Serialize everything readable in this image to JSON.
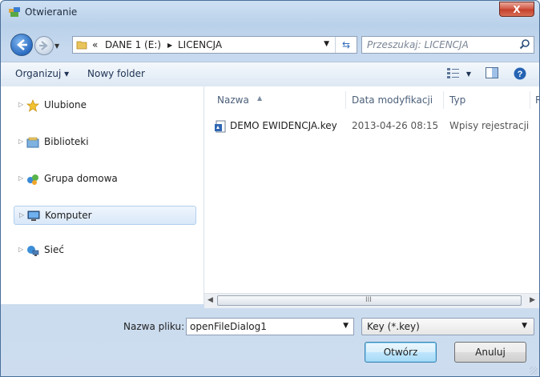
{
  "window": {
    "title": "Otwieranie",
    "close_label": "X"
  },
  "nav": {
    "address": {
      "overflow": "«",
      "segments": [
        "DANE 1 (E:)",
        "LICENCJA"
      ]
    },
    "search_placeholder": "Przeszukaj: LICENCJA"
  },
  "toolbar": {
    "organize": "Organizuj ▾",
    "new_folder": "Nowy folder"
  },
  "sidebar": {
    "items": [
      {
        "label": "Ulubione",
        "icon": "star-icon"
      },
      {
        "label": "Biblioteki",
        "icon": "libraries-icon"
      },
      {
        "label": "Grupa domowa",
        "icon": "homegroup-icon"
      },
      {
        "label": "Komputer",
        "icon": "computer-icon",
        "selected": true
      },
      {
        "label": "Sieć",
        "icon": "network-icon"
      }
    ]
  },
  "columns": [
    "Nazwa",
    "Data modyfikacji",
    "Typ",
    "R"
  ],
  "files": [
    {
      "name": "DEMO EWIDENCJA.key",
      "date": "2013-04-26 08:15",
      "type": "Wpisy rejestracji",
      "icon": "registry-file-icon"
    }
  ],
  "bottom": {
    "filename_label": "Nazwa pliku:",
    "filename_value": "openFileDialog1",
    "filetype_value": "Key (*.key)",
    "open_button": "Otwórz",
    "cancel_button": "Anuluj"
  },
  "scrollbar_grip": "III"
}
